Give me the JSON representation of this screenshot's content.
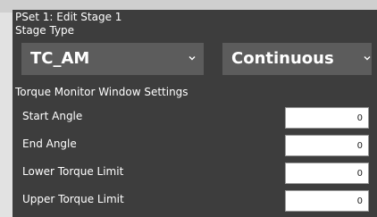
{
  "window": {
    "title": "PSet 1: Edit Stage 1"
  },
  "stage_type": {
    "label": "Stage Type",
    "type_select": {
      "value": "TC_AM"
    },
    "mode_select": {
      "value": "Continuous"
    }
  },
  "torque_monitor": {
    "heading": "Torque Monitor Window Settings",
    "fields": [
      {
        "label": "Start Angle",
        "value": "0"
      },
      {
        "label": "End Angle",
        "value": "0"
      },
      {
        "label": "Lower Torque Limit",
        "value": "0"
      },
      {
        "label": "Upper Torque Limit",
        "value": "0"
      }
    ]
  },
  "icons": {
    "dropdown_arrow": "chevron-down-icon"
  },
  "colors": {
    "panel_background": "#3d3d3d",
    "dropdown_background": "#5c5c5c",
    "page_background": "#e2e2e2",
    "text": "#ffffff",
    "input_background": "#ffffff"
  }
}
